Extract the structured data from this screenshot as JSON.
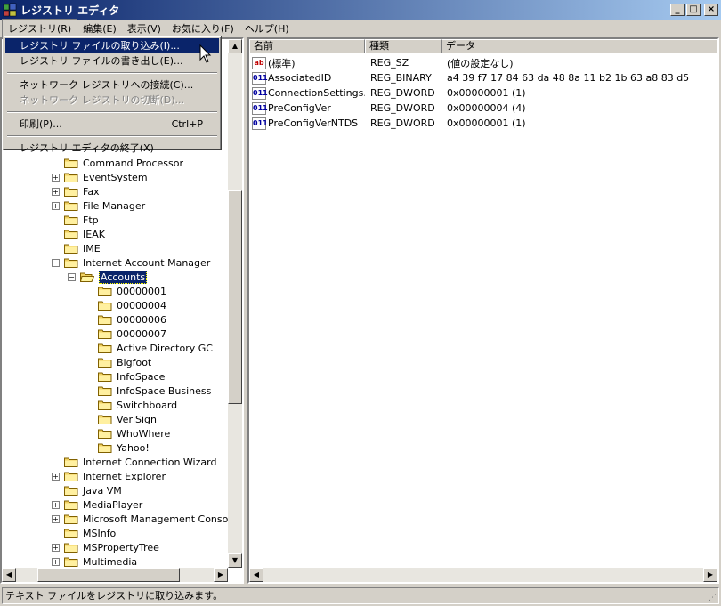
{
  "window": {
    "title": "レジストリ エディタ",
    "min": "_",
    "max": "□",
    "close": "×"
  },
  "menubar": {
    "items": [
      "レジストリ(R)",
      "編集(E)",
      "表示(V)",
      "お気に入り(F)",
      "ヘルプ(H)"
    ]
  },
  "dropdown": {
    "import": "レジストリ ファイルの取り込み(I)...",
    "export": "レジストリ ファイルの書き出し(E)...",
    "connect": "ネットワーク レジストリへの接続(C)...",
    "disconnect": "ネットワーク レジストリの切断(D)...",
    "print": "印刷(P)...",
    "print_shortcut": "Ctrl+P",
    "exit": "レジストリ エディタの終了(X)"
  },
  "tree": {
    "items": [
      {
        "label": "Command Processor",
        "expander": ""
      },
      {
        "label": "EventSystem",
        "expander": "+"
      },
      {
        "label": "Fax",
        "expander": "+"
      },
      {
        "label": "File Manager",
        "expander": "+"
      },
      {
        "label": "Ftp",
        "expander": ""
      },
      {
        "label": "IEAK",
        "expander": ""
      },
      {
        "label": "IME",
        "expander": ""
      },
      {
        "label": "Internet Account Manager",
        "expander": "−"
      },
      {
        "label": "Accounts",
        "expander": "−"
      },
      {
        "label": "00000001",
        "expander": ""
      },
      {
        "label": "00000004",
        "expander": ""
      },
      {
        "label": "00000006",
        "expander": ""
      },
      {
        "label": "00000007",
        "expander": ""
      },
      {
        "label": "Active Directory GC",
        "expander": ""
      },
      {
        "label": "Bigfoot",
        "expander": ""
      },
      {
        "label": "InfoSpace",
        "expander": ""
      },
      {
        "label": "InfoSpace Business",
        "expander": ""
      },
      {
        "label": "Switchboard",
        "expander": ""
      },
      {
        "label": "VeriSign",
        "expander": ""
      },
      {
        "label": "WhoWhere",
        "expander": ""
      },
      {
        "label": "Yahoo!",
        "expander": ""
      },
      {
        "label": "Internet Connection Wizard",
        "expander": ""
      },
      {
        "label": "Internet Explorer",
        "expander": "+"
      },
      {
        "label": "Java VM",
        "expander": ""
      },
      {
        "label": "MediaPlayer",
        "expander": "+"
      },
      {
        "label": "Microsoft Management Console",
        "expander": "+"
      },
      {
        "label": "MSInfo",
        "expander": ""
      },
      {
        "label": "MSPropertyTree",
        "expander": "+"
      },
      {
        "label": "Multimedia",
        "expander": "+"
      }
    ]
  },
  "values": {
    "headers": {
      "name": "名前",
      "type": "種類",
      "data": "データ"
    },
    "rows": [
      {
        "icon": "ab",
        "name": "(標準)",
        "type": "REG_SZ",
        "data": "(値の設定なし)"
      },
      {
        "icon": "011",
        "name": "AssociatedID",
        "type": "REG_BINARY",
        "data": "a4 39 f7 17 84 63 da 48 8a 11 b2 1b 63 a8 83 d5"
      },
      {
        "icon": "011",
        "name": "ConnectionSettings...",
        "type": "REG_DWORD",
        "data": "0x00000001 (1)"
      },
      {
        "icon": "011",
        "name": "PreConfigVer",
        "type": "REG_DWORD",
        "data": "0x00000004 (4)"
      },
      {
        "icon": "011",
        "name": "PreConfigVerNTDS",
        "type": "REG_DWORD",
        "data": "0x00000001 (1)"
      }
    ]
  },
  "status": {
    "text": "テキスト ファイルをレジストリに取り込みます。"
  }
}
